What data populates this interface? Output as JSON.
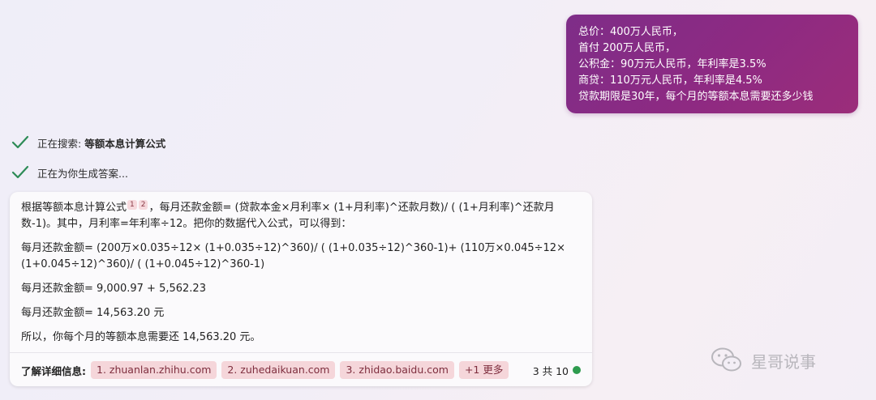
{
  "user_message": {
    "lines": [
      "总价：400万人民币，",
      "首付 200万人民币，",
      "公积金：90万元人民币，年利率是3.5%",
      "商贷：110万元人民币，年利率是4.5%",
      "贷款期限是30年，每个月的等额本息需要还多少钱"
    ]
  },
  "status": {
    "searching_label": "正在搜索:",
    "searching_query": "等额本息计算公式",
    "generating_label": "正在为你生成答案..."
  },
  "answer": {
    "p1_a": "根据等额本息计算公式",
    "ref1": "1",
    "ref2": "2",
    "p1_b": "，每月还款金额= (贷款本金×月利率× (1+月利率)^还款月数)/ ( (1+月利率)^还款月数-1)。其中，月利率=年利率÷12。把你的数据代入公式，可以得到：",
    "p2": "每月还款金额= (200万×0.035÷12× (1+0.035÷12)^360)/ ( (1+0.035÷12)^360-1)+ (110万×0.045÷12× (1+0.045÷12)^360)/ ( (1+0.045÷12)^360-1)",
    "p3": "每月还款金额= 9,000.97 + 5,562.23",
    "p4": "每月还款金额= 14,563.20 元",
    "p5": "所以，你每个月的等额本息需要还 14,563.20 元。"
  },
  "footer": {
    "learn_more": "了解详细信息:",
    "links": [
      "1. zhuanlan.zhihu.com",
      "2. zuhedaikuan.com",
      "3. zhidao.baidu.com",
      "+1 更多"
    ],
    "count": "3 共 10",
    "status_color": "#2e9b4e"
  },
  "watermark": {
    "text": "星哥说事",
    "icon": "wechat-icon"
  },
  "colors": {
    "user_bubble": "#8e2a82",
    "chip_bg": "#f5d6da",
    "check": "#2e8b57"
  }
}
